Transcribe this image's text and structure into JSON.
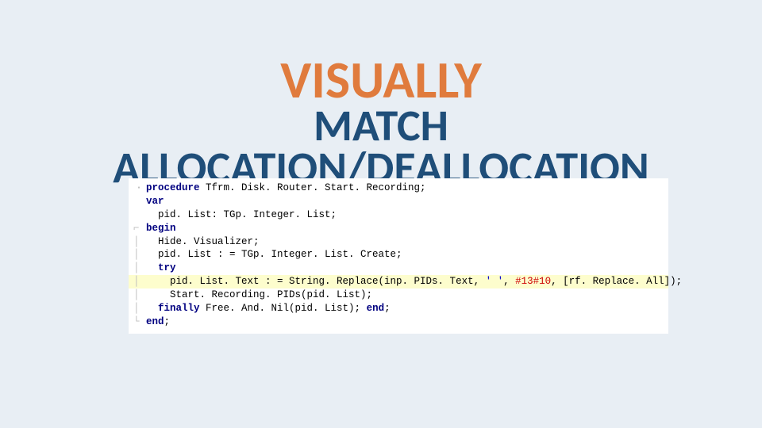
{
  "title": {
    "line1": "VISUALLY",
    "line2": "MATCH",
    "line3": "ALLOCATION/DEALLOCATION"
  },
  "code": {
    "l0_kw": "procedure",
    "l0_rest": " Tfrm. Disk. Router. Start. Recording;",
    "l1_kw": "var",
    "l2": "  pid. List: TGp. Integer. List;",
    "l3_kw": "begin",
    "l4": "  Hide. Visualizer;",
    "l5": "  pid. List : = TGp. Integer. List. Create;",
    "l6_kw": "  try",
    "l7_a": "    pid. List. Text : = String. Replace(inp. PIDs. Text, ",
    "l7_str": "' '",
    "l7_b": ", ",
    "l7_num": "#13#10",
    "l7_c": ", [rf. Replace. All]);",
    "l8": "    Start. Recording. PIDs(pid. List);",
    "l9_kw": "  finally",
    "l9_rest": " Free. And. Nil(pid. List); ",
    "l9_end": "end",
    "l9_semi": ";",
    "l10_kw": "end",
    "l10_semi": ";"
  }
}
